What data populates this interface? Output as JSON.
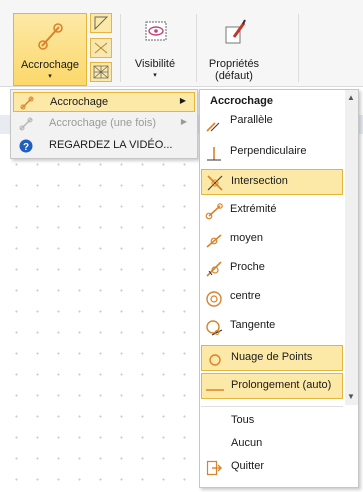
{
  "ribbon": {
    "accrochage_label": "Accrochage",
    "visibilite_label": "Visibilité",
    "proprietes_label_line1": "Propriétés",
    "proprietes_label_line2": "(défaut)",
    "caret": "▾"
  },
  "left_menu": {
    "items": [
      {
        "label": "Accrochage",
        "arrow": "▶",
        "icon": "snap-icon"
      },
      {
        "label": "Accrochage (une fois)",
        "arrow": "▶",
        "icon": "snap-once-icon"
      },
      {
        "label": "REGARDEZ LA VIDÉO...",
        "icon": "help-icon"
      }
    ]
  },
  "submenu": {
    "header": "Accrochage",
    "items": [
      {
        "label": "Parallèle",
        "icon": "parallel-icon",
        "highlighted": false
      },
      {
        "label": "Perpendiculaire",
        "icon": "perpendicular-icon",
        "highlighted": false
      },
      {
        "label": "Intersection",
        "icon": "intersection-icon",
        "highlighted": true
      },
      {
        "label": "Extrémité",
        "icon": "endpoint-icon",
        "highlighted": false
      },
      {
        "label": "moyen",
        "icon": "midpoint-icon",
        "highlighted": false
      },
      {
        "label": "Proche",
        "icon": "nearest-icon",
        "highlighted": false
      },
      {
        "label": "centre",
        "icon": "center-icon",
        "highlighted": false
      },
      {
        "label": "Tangente",
        "icon": "tangent-icon",
        "highlighted": false
      },
      {
        "label": "Nuage de Points",
        "icon": "point-cloud-icon",
        "highlighted": true
      },
      {
        "label": "Prolongement (auto)",
        "icon": "extension-icon",
        "highlighted": true
      }
    ],
    "tous": "Tous",
    "aucun": "Aucun",
    "quitter": "Quitter",
    "scroll_up": "▲",
    "scroll_down": "▼"
  },
  "colors": {
    "highlight_fill": "#fde9a7",
    "highlight_border": "#e5b53c",
    "icon_orange": "#d9822b"
  }
}
